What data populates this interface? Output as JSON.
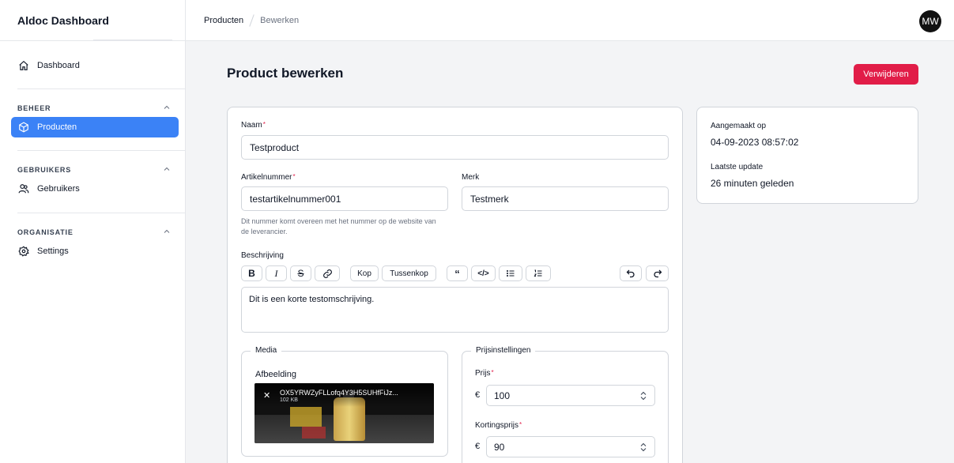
{
  "app": {
    "title": "Aldoc Dashboard"
  },
  "sidebar": {
    "dashboard": "Dashboard",
    "sections": [
      {
        "label": "BEHEER",
        "item": "Producten"
      },
      {
        "label": "GEBRUIKERS",
        "item": "Gebruikers"
      },
      {
        "label": "ORGANISATIE",
        "item": "Settings"
      }
    ]
  },
  "breadcrumb": {
    "current": "Producten",
    "page": "Bewerken"
  },
  "user": {
    "initials": "MW"
  },
  "page": {
    "title": "Product bewerken",
    "delete_label": "Verwijderen"
  },
  "form": {
    "name_label": "Naam",
    "name_value": "Testproduct",
    "article_label": "Artikelnummer",
    "article_value": "testartikelnummer001",
    "article_hint": "Dit nummer komt overeen met het nummer op de website van de leverancier.",
    "brand_label": "Merk",
    "brand_value": "Testmerk",
    "description_label": "Beschrijving",
    "description_value": "Dit is een korte testomschrijving.",
    "toolbar": {
      "heading": "Kop",
      "subheading": "Tussenkop"
    },
    "media": {
      "legend": "Media",
      "image_label": "Afbeelding",
      "file_name": "OX5YRWZyFLLofq4Y3H5SUHfFiJz...",
      "file_size": "102 KB"
    },
    "pricing": {
      "legend": "Prijsinstellingen",
      "price_label": "Prijs",
      "price_value": "100",
      "discount_label": "Kortingsprijs",
      "discount_value": "90",
      "currency": "€"
    }
  },
  "meta": {
    "created_label": "Aangemaakt op",
    "created_value": "04-09-2023 08:57:02",
    "updated_label": "Laatste update",
    "updated_value": "26 minuten geleden"
  },
  "colors": {
    "accent": "#3b82f6",
    "danger": "#e11d48"
  }
}
